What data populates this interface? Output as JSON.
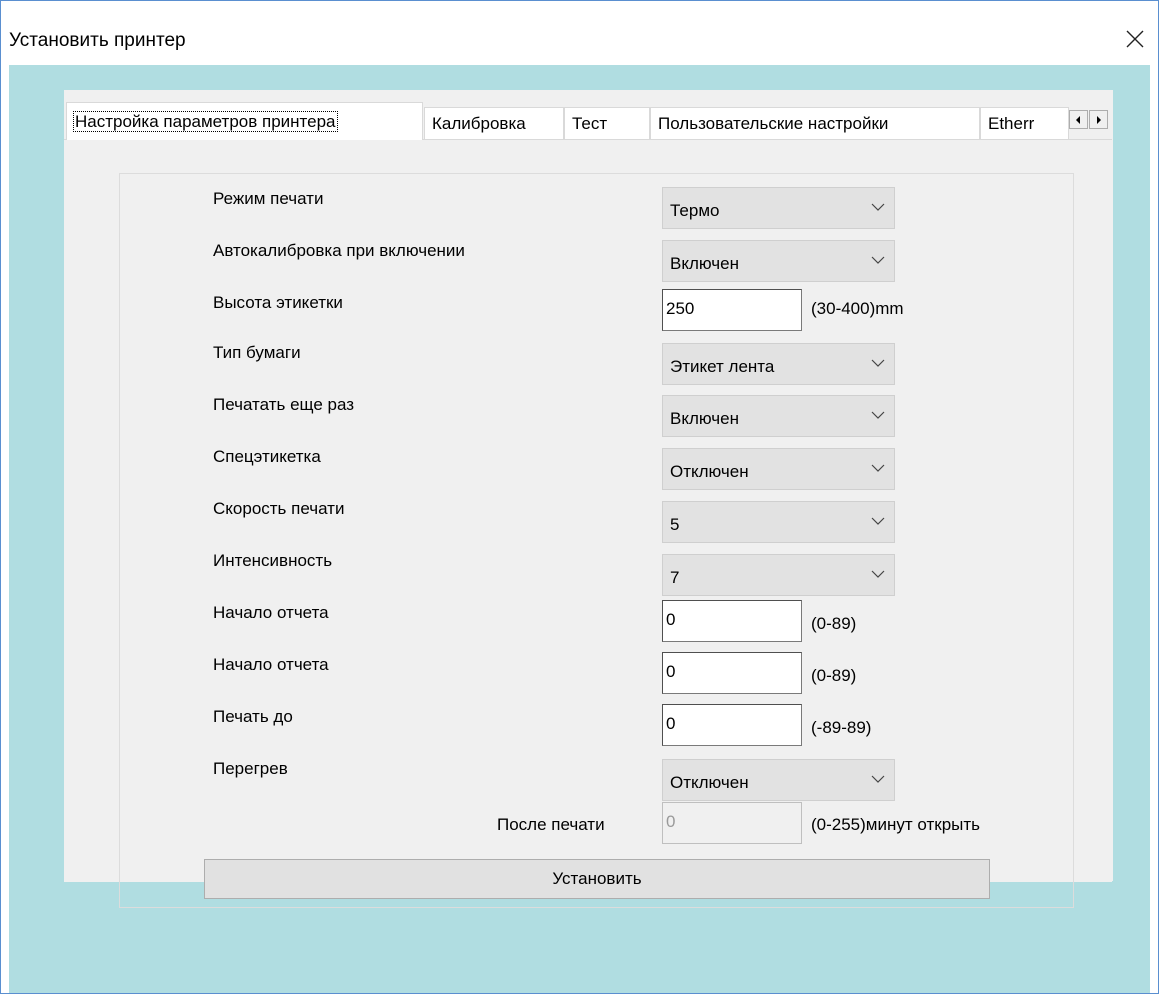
{
  "window": {
    "title": "Установить принтер"
  },
  "tabs": [
    {
      "label": "Настройка параметров принтера"
    },
    {
      "label": "Калибровка"
    },
    {
      "label": "Тест"
    },
    {
      "label": "Пользовательские настройки"
    },
    {
      "label": "Etherr"
    }
  ],
  "form": {
    "print_mode": {
      "label": "Режим печати",
      "value": "Термо"
    },
    "autocalibration": {
      "label": "Автокалибровка при включении",
      "value": "Включен"
    },
    "label_height": {
      "label": "Высота этикетки",
      "value": "250",
      "unit": "(30-400)mm"
    },
    "paper_type": {
      "label": "Тип бумаги",
      "value": "Этикет лента"
    },
    "reprint": {
      "label": "Печатать еще раз",
      "value": "Включен"
    },
    "special_label": {
      "label": "Спецэтикетка",
      "value": "Отключен"
    },
    "print_speed": {
      "label": "Скорость печати",
      "value": "5"
    },
    "intensity": {
      "label": "Интенсивность",
      "value": "7"
    },
    "report_start_1": {
      "label": "Начало отчета",
      "value": "0",
      "unit": "(0-89)"
    },
    "report_start_2": {
      "label": "Начало отчета",
      "value": "0",
      "unit": "(0-89)"
    },
    "print_to": {
      "label": "Печать до",
      "value": "0",
      "unit": "(-89-89)"
    },
    "overheat": {
      "label": "Перегрев",
      "value": "Отключен"
    },
    "after_print": {
      "label": "После печати",
      "value": "0",
      "unit": "(0-255)минут открыть"
    },
    "submit_label": "Установить"
  },
  "icons": {
    "close": "close-icon",
    "chevron": "chevron-down-icon",
    "tab_left": "arrow-left-icon",
    "tab_right": "arrow-right-icon"
  },
  "colors": {
    "client_background": "#b0dde1",
    "panel_background": "#f0f0f0",
    "combo_background": "#e2e2e2"
  }
}
